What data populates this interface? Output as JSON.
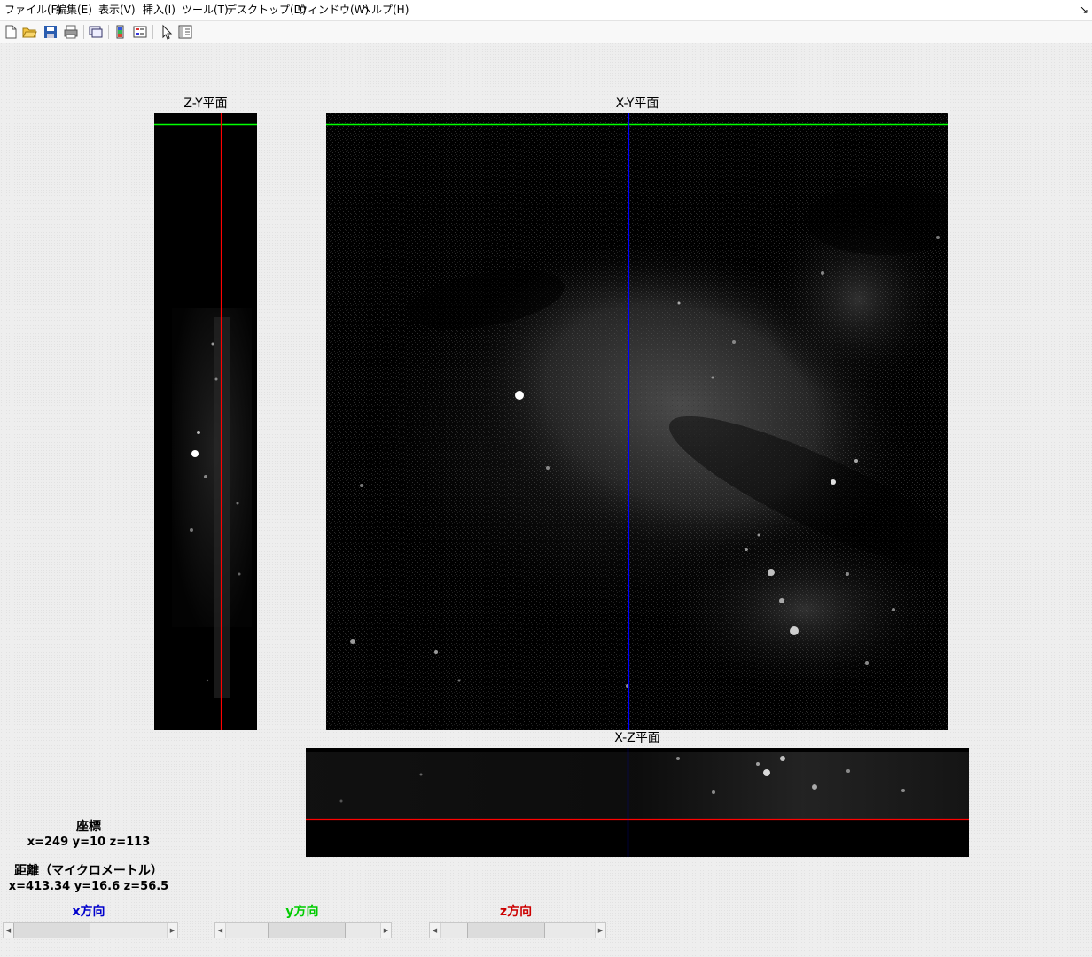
{
  "menubar": {
    "items": [
      {
        "label": "ファイル(F)"
      },
      {
        "label": "編集(E)"
      },
      {
        "label": "表示(V)"
      },
      {
        "label": "挿入(I)"
      },
      {
        "label": "ツール(T)"
      },
      {
        "label": "デスクトップ(D)"
      },
      {
        "label": "ウィンドウ(W)"
      },
      {
        "label": "ヘルプ(H)"
      }
    ],
    "corner_icon": "dock-arrow-icon"
  },
  "toolbar": {
    "buttons": [
      {
        "icon": "new-file-icon"
      },
      {
        "icon": "open-folder-icon"
      },
      {
        "icon": "save-icon"
      },
      {
        "icon": "print-icon"
      },
      {
        "icon": "link-figure-icon"
      },
      {
        "icon": "colorbar-icon"
      },
      {
        "icon": "legend-icon"
      },
      {
        "icon": "pointer-icon"
      },
      {
        "icon": "property-inspector-icon"
      }
    ]
  },
  "planes": {
    "zy": {
      "title": "Z-Y平面"
    },
    "xy": {
      "title": "X-Y平面"
    },
    "xz": {
      "title": "X-Z平面"
    }
  },
  "crosshair_colors": {
    "x": "#0000ff",
    "y": "#00ff00",
    "z": "#ff0000"
  },
  "info": {
    "coord_label": "座標",
    "coord_value": "x=249 y=10 z=113",
    "distance_label": "距離（マイクロメートル）",
    "distance_value": "x=413.34  y=16.6  z=56.5"
  },
  "sliders": {
    "x": {
      "label": "x方向",
      "color": "#0000cc",
      "position": 0.0
    },
    "y": {
      "label": "y方向",
      "color": "#00cc00",
      "position": 0.55
    },
    "z": {
      "label": "z方向",
      "color": "#cc0000",
      "position": 0.35
    }
  }
}
